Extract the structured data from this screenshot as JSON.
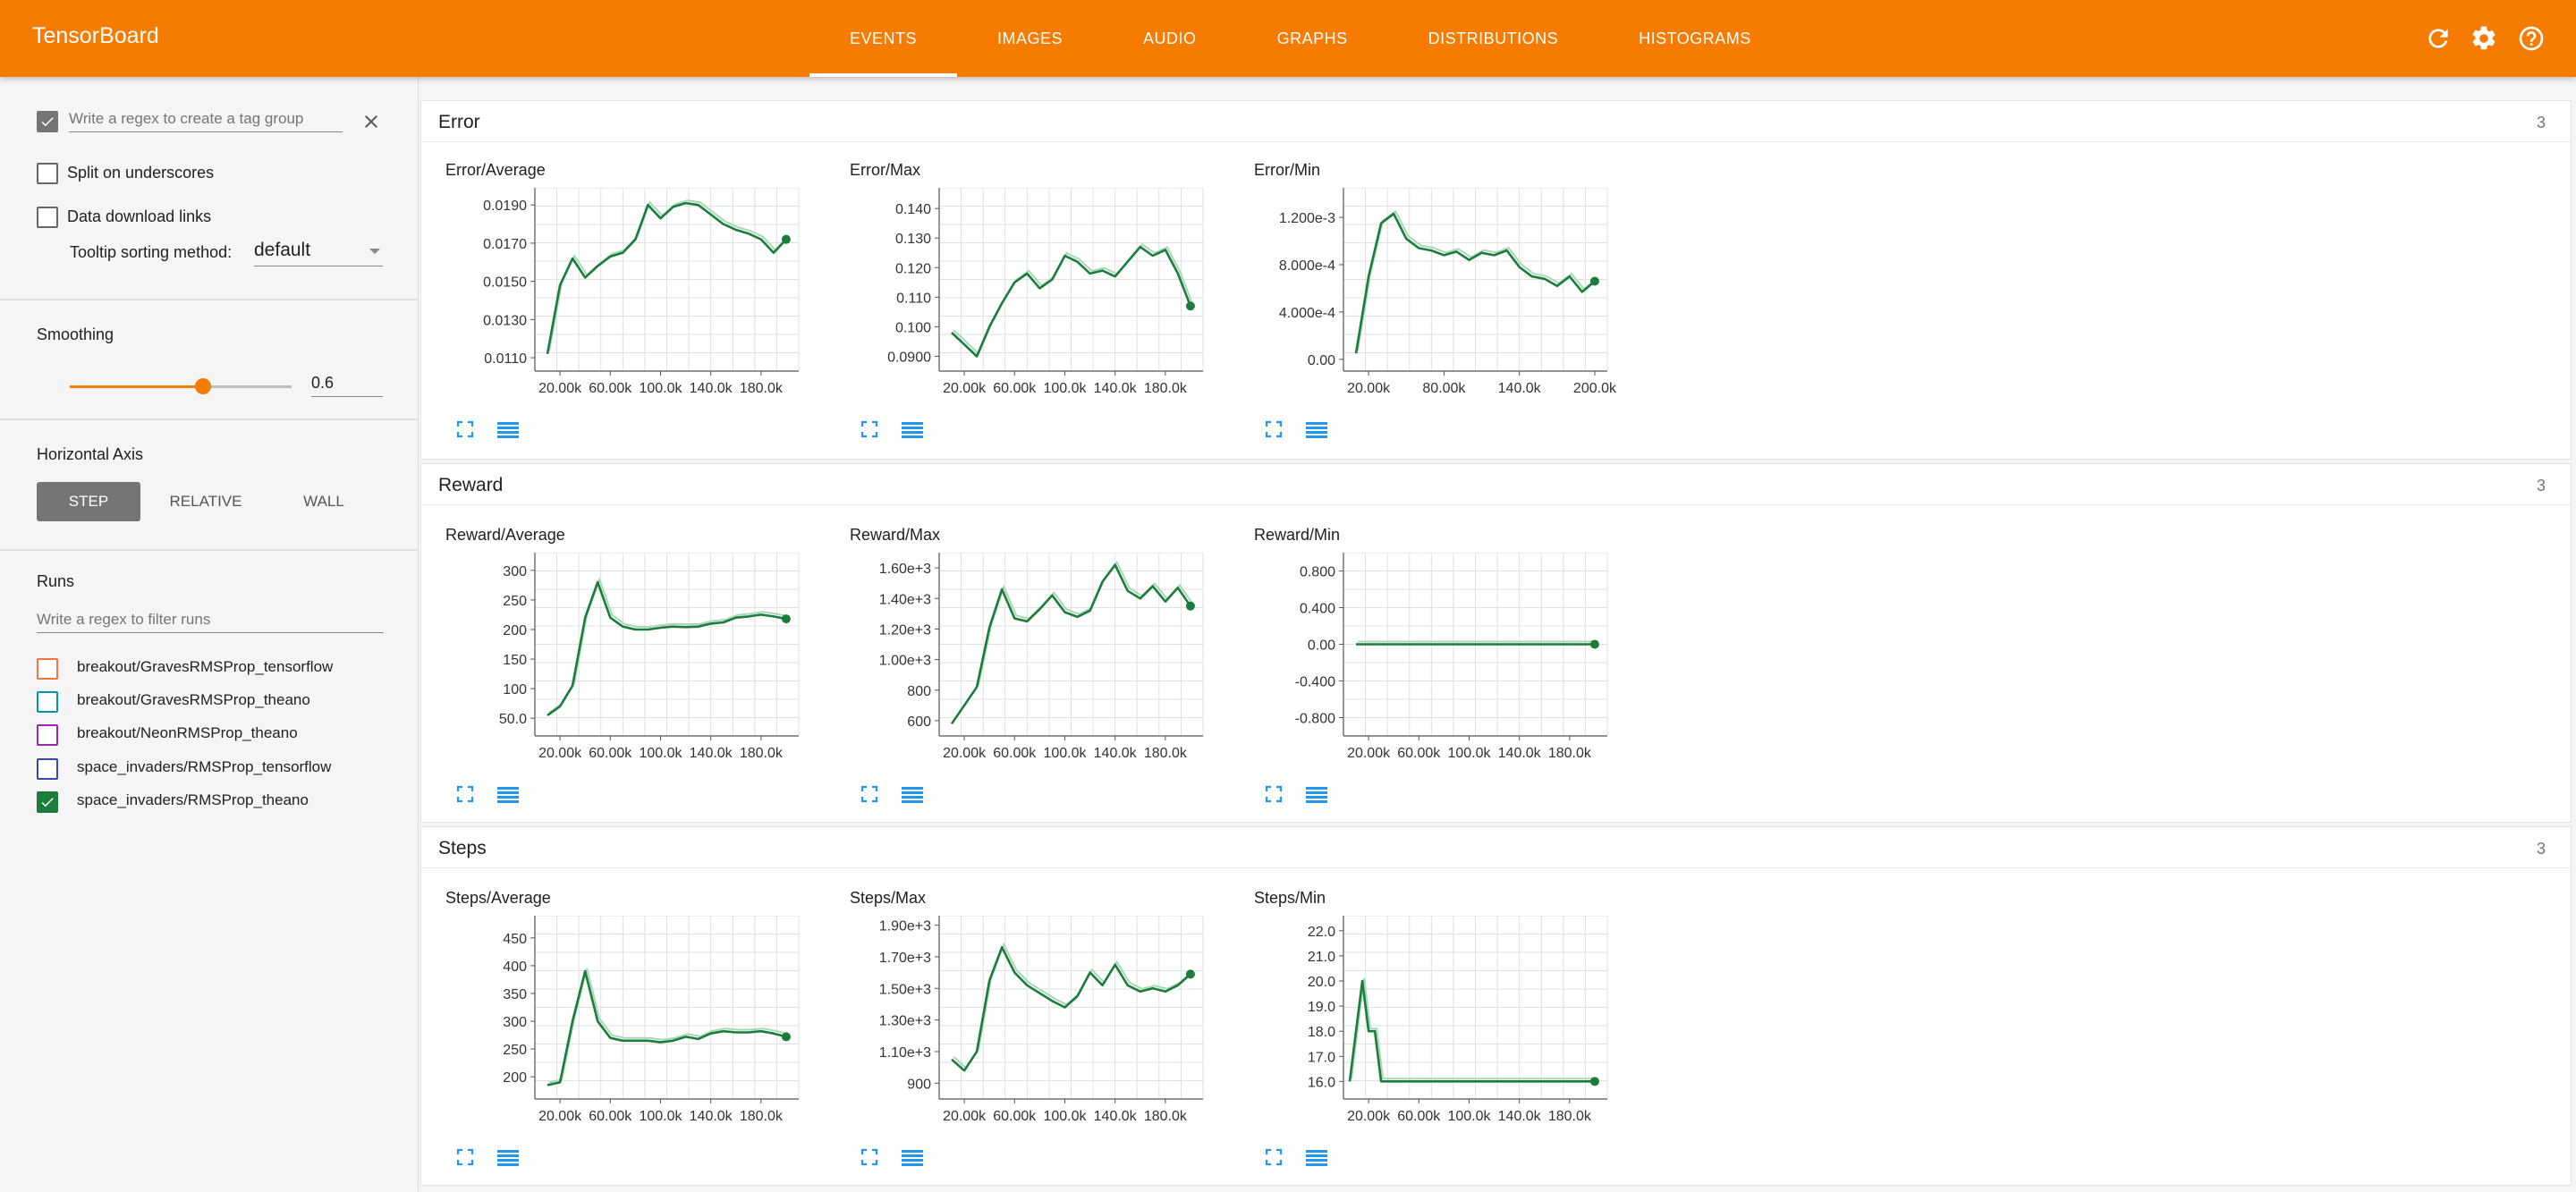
{
  "app": {
    "title": "TensorBoard"
  },
  "tabs": [
    {
      "label": "EVENTS",
      "active": true
    },
    {
      "label": "IMAGES"
    },
    {
      "label": "AUDIO"
    },
    {
      "label": "GRAPHS"
    },
    {
      "label": "DISTRIBUTIONS"
    },
    {
      "label": "HISTOGRAMS"
    }
  ],
  "toolbar_icons": [
    "refresh-icon",
    "settings-icon",
    "help-icon"
  ],
  "colors": {
    "accent": "#f57c00",
    "line": "#1b7c3b",
    "line_raw": "#a8d8b8"
  },
  "sidebar": {
    "tag_group_placeholder": "Write a regex to create a tag group",
    "tag_group_checked": true,
    "split_label": "Split on underscores",
    "download_label": "Data download links",
    "tooltip_label": "Tooltip sorting method:",
    "tooltip_value": "default",
    "smoothing_label": "Smoothing",
    "smoothing_value": "0.6",
    "smoothing_fraction": 0.6,
    "haxis_label": "Horizontal Axis",
    "haxis_options": [
      "STEP",
      "RELATIVE",
      "WALL"
    ],
    "haxis_selected": "STEP",
    "runs_label": "Runs",
    "runs_placeholder": "Write a regex to filter runs",
    "runs": [
      {
        "name": "breakout/GravesRMSProp_tensorflow",
        "color": "#ff7043",
        "checked": false
      },
      {
        "name": "breakout/GravesRMSProp_theano",
        "color": "#0097a7",
        "checked": false
      },
      {
        "name": "breakout/NeonRMSProp_theano",
        "color": "#9c27b0",
        "checked": false
      },
      {
        "name": "space_invaders/RMSProp_tensorflow",
        "color": "#3949ab",
        "checked": false
      },
      {
        "name": "space_invaders/RMSProp_theano",
        "color": "#1b7c3b",
        "checked": true
      }
    ]
  },
  "sections": [
    {
      "title": "Error",
      "count": "3"
    },
    {
      "title": "Reward",
      "count": "3"
    },
    {
      "title": "Steps",
      "count": "3"
    }
  ],
  "chart_data": [
    {
      "type": "line",
      "title": "Error/Average",
      "x": [
        10,
        20,
        30,
        40,
        50,
        60,
        70,
        80,
        90,
        100,
        110,
        120,
        130,
        140,
        150,
        160,
        170,
        180,
        190,
        200
      ],
      "y": [
        0.0112,
        0.0148,
        0.0162,
        0.0152,
        0.0158,
        0.0163,
        0.0165,
        0.0172,
        0.019,
        0.0183,
        0.0189,
        0.0191,
        0.019,
        0.0185,
        0.018,
        0.0177,
        0.0175,
        0.0172,
        0.0165,
        0.0172
      ],
      "ylim": [
        0.0103,
        0.0199
      ],
      "xlim": [
        0,
        210
      ],
      "yticks": [
        "0.0110",
        "0.0130",
        "0.0150",
        "0.0170",
        "0.0190"
      ],
      "ytick_values": [
        0.011,
        0.013,
        0.015,
        0.017,
        0.019
      ],
      "xticks": [
        "20.00k",
        "60.00k",
        "100.0k",
        "140.0k",
        "180.0k"
      ],
      "xtick_values": [
        20,
        60,
        100,
        140,
        180
      ]
    },
    {
      "type": "line",
      "title": "Error/Max",
      "x": [
        10,
        20,
        30,
        40,
        50,
        60,
        70,
        80,
        90,
        100,
        110,
        120,
        130,
        140,
        150,
        160,
        170,
        180,
        190,
        200
      ],
      "y": [
        0.098,
        0.094,
        0.09,
        0.1,
        0.108,
        0.115,
        0.118,
        0.113,
        0.116,
        0.124,
        0.122,
        0.118,
        0.119,
        0.117,
        0.122,
        0.127,
        0.124,
        0.126,
        0.118,
        0.107
      ],
      "ylim": [
        0.085,
        0.147
      ],
      "xlim": [
        0,
        210
      ],
      "yticks": [
        "0.0900",
        "0.100",
        "0.110",
        "0.120",
        "0.130",
        "0.140"
      ],
      "ytick_values": [
        0.09,
        0.1,
        0.11,
        0.12,
        0.13,
        0.14
      ],
      "xticks": [
        "20.00k",
        "60.00k",
        "100.0k",
        "140.0k",
        "180.0k"
      ],
      "xtick_values": [
        20,
        60,
        100,
        140,
        180
      ]
    },
    {
      "type": "line",
      "title": "Error/Min",
      "x": [
        10,
        20,
        30,
        40,
        50,
        60,
        70,
        80,
        90,
        100,
        110,
        120,
        130,
        140,
        150,
        160,
        170,
        180,
        190,
        200
      ],
      "y": [
        5e-05,
        0.0007,
        0.00115,
        0.00123,
        0.00102,
        0.00094,
        0.00092,
        0.00088,
        0.00091,
        0.00084,
        0.0009,
        0.00088,
        0.00092,
        0.00078,
        0.0007,
        0.00068,
        0.00062,
        0.0007,
        0.00057,
        0.00066
      ],
      "ylim": [
        -0.0001,
        0.00145
      ],
      "xlim": [
        0,
        210
      ],
      "yticks": [
        "0.00",
        "4.000e-4",
        "8.000e-4",
        "1.200e-3"
      ],
      "ytick_values": [
        0,
        0.0004,
        0.0008,
        0.0012
      ],
      "xticks": [
        "20.00k",
        "80.00k",
        "140.0k",
        "200.0k"
      ],
      "xtick_values": [
        20,
        80,
        140,
        200
      ]
    },
    {
      "type": "line",
      "title": "Reward/Average",
      "x": [
        10,
        20,
        30,
        40,
        50,
        60,
        70,
        80,
        90,
        100,
        110,
        120,
        130,
        140,
        150,
        160,
        170,
        180,
        190,
        200
      ],
      "y": [
        55,
        70,
        105,
        220,
        280,
        220,
        205,
        200,
        200,
        203,
        205,
        204,
        205,
        210,
        212,
        220,
        222,
        225,
        222,
        218
      ],
      "ylim": [
        20,
        330
      ],
      "xlim": [
        0,
        210
      ],
      "yticks": [
        "50.0",
        "100",
        "150",
        "200",
        "250",
        "300"
      ],
      "ytick_values": [
        50,
        100,
        150,
        200,
        250,
        300
      ],
      "xticks": [
        "20.00k",
        "60.00k",
        "100.0k",
        "140.0k",
        "180.0k"
      ],
      "xtick_values": [
        20,
        60,
        100,
        140,
        180
      ]
    },
    {
      "type": "line",
      "title": "Reward/Max",
      "x": [
        10,
        20,
        30,
        40,
        50,
        60,
        70,
        80,
        90,
        100,
        110,
        120,
        130,
        140,
        150,
        160,
        170,
        180,
        190,
        200
      ],
      "y": [
        580,
        700,
        820,
        1210,
        1460,
        1270,
        1250,
        1330,
        1420,
        1310,
        1280,
        1320,
        1510,
        1620,
        1450,
        1400,
        1480,
        1380,
        1470,
        1350
      ],
      "ylim": [
        500,
        1700
      ],
      "xlim": [
        0,
        210
      ],
      "yticks": [
        "600",
        "800",
        "1.00e+3",
        "1.20e+3",
        "1.40e+3",
        "1.60e+3"
      ],
      "ytick_values": [
        600,
        800,
        1000,
        1200,
        1400,
        1600
      ],
      "xticks": [
        "20.00k",
        "60.00k",
        "100.0k",
        "140.0k",
        "180.0k"
      ],
      "xtick_values": [
        20,
        60,
        100,
        140,
        180
      ]
    },
    {
      "type": "line",
      "title": "Reward/Min",
      "x": [
        10,
        200
      ],
      "y": [
        0,
        0
      ],
      "ylim": [
        -1.0,
        1.0
      ],
      "xlim": [
        0,
        210
      ],
      "yticks": [
        "-0.800",
        "-0.400",
        "0.00",
        "0.400",
        "0.800"
      ],
      "ytick_values": [
        -0.8,
        -0.4,
        0,
        0.4,
        0.8
      ],
      "xticks": [
        "20.00k",
        "60.00k",
        "100.0k",
        "140.0k",
        "180.0k"
      ],
      "xtick_values": [
        20,
        60,
        100,
        140,
        180
      ]
    },
    {
      "type": "line",
      "title": "Steps/Average",
      "x": [
        10,
        20,
        30,
        40,
        50,
        60,
        70,
        80,
        90,
        100,
        110,
        120,
        130,
        140,
        150,
        160,
        170,
        180,
        190,
        200
      ],
      "y": [
        185,
        190,
        300,
        390,
        300,
        270,
        265,
        265,
        265,
        262,
        265,
        272,
        268,
        278,
        282,
        280,
        280,
        282,
        278,
        272
      ],
      "ylim": [
        160,
        490
      ],
      "xlim": [
        0,
        210
      ],
      "yticks": [
        "200",
        "250",
        "300",
        "350",
        "400",
        "450"
      ],
      "ytick_values": [
        200,
        250,
        300,
        350,
        400,
        450
      ],
      "xticks": [
        "20.00k",
        "60.00k",
        "100.0k",
        "140.0k",
        "180.0k"
      ],
      "xtick_values": [
        20,
        60,
        100,
        140,
        180
      ]
    },
    {
      "type": "line",
      "title": "Steps/Max",
      "x": [
        10,
        20,
        30,
        40,
        50,
        60,
        70,
        80,
        90,
        100,
        110,
        120,
        130,
        140,
        150,
        160,
        170,
        180,
        190,
        200
      ],
      "y": [
        1050,
        980,
        1100,
        1550,
        1760,
        1600,
        1520,
        1470,
        1420,
        1380,
        1450,
        1600,
        1520,
        1650,
        1520,
        1480,
        1500,
        1480,
        1520,
        1590
      ],
      "ylim": [
        800,
        1960
      ],
      "xlim": [
        0,
        210
      ],
      "yticks": [
        "900",
        "1.10e+3",
        "1.30e+3",
        "1.50e+3",
        "1.70e+3",
        "1.90e+3"
      ],
      "ytick_values": [
        900,
        1100,
        1300,
        1500,
        1700,
        1900
      ],
      "xticks": [
        "20.00k",
        "60.00k",
        "100.0k",
        "140.0k",
        "180.0k"
      ],
      "xtick_values": [
        20,
        60,
        100,
        140,
        180
      ]
    },
    {
      "type": "line",
      "title": "Steps/Min",
      "x": [
        5,
        10,
        15,
        20,
        25,
        30,
        200
      ],
      "y": [
        16,
        18,
        20,
        18,
        18,
        16,
        16
      ],
      "ylim": [
        15.3,
        22.6
      ],
      "xlim": [
        0,
        210
      ],
      "yticks": [
        "16.0",
        "17.0",
        "18.0",
        "19.0",
        "20.0",
        "21.0",
        "22.0"
      ],
      "ytick_values": [
        16,
        17,
        18,
        19,
        20,
        21,
        22
      ],
      "xticks": [
        "20.00k",
        "60.00k",
        "100.0k",
        "140.0k",
        "180.0k"
      ],
      "xtick_values": [
        20,
        60,
        100,
        140,
        180
      ]
    }
  ]
}
